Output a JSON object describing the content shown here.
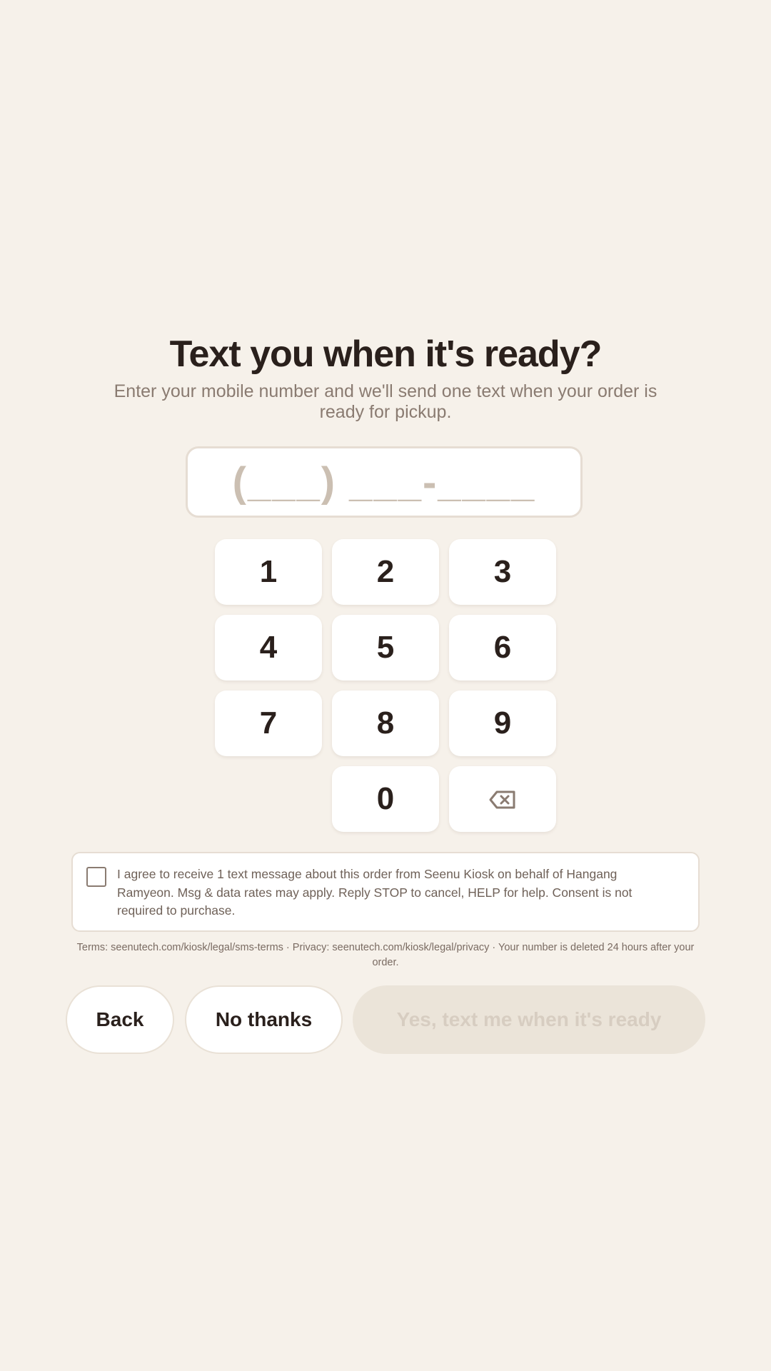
{
  "header": {
    "title": "Text you when it's ready?",
    "subtitle": "Enter your mobile number and we'll send one text when your order is ready for pickup."
  },
  "phone": {
    "mask": "(___) ___-____"
  },
  "keypad": {
    "keys": [
      "1",
      "2",
      "3",
      "4",
      "5",
      "6",
      "7",
      "8",
      "9",
      "0"
    ],
    "backspace_icon": "backspace-icon"
  },
  "consent": {
    "checked": false,
    "text": "I agree to receive 1 text message about this order from Seenu Kiosk on behalf of Hangang Ramyeon. Msg & data rates may apply. Reply STOP to cancel, HELP for help. Consent is not required to purchase."
  },
  "terms": {
    "text": "Terms: seenutech.com/kiosk/legal/sms-terms · Privacy: seenutech.com/kiosk/legal/privacy · Your number is deleted 24 hours after your order."
  },
  "actions": {
    "back_label": "Back",
    "no_thanks_label": "No thanks",
    "confirm_label": "Yes, text me when it's ready"
  },
  "colors": {
    "background": "#f6f1ea",
    "text_primary": "#2a201c",
    "text_secondary": "#8a7b71",
    "placeholder": "#cbbfb2",
    "disabled_button_bg": "#ebe4d9",
    "disabled_button_text": "#d7cdc1"
  }
}
